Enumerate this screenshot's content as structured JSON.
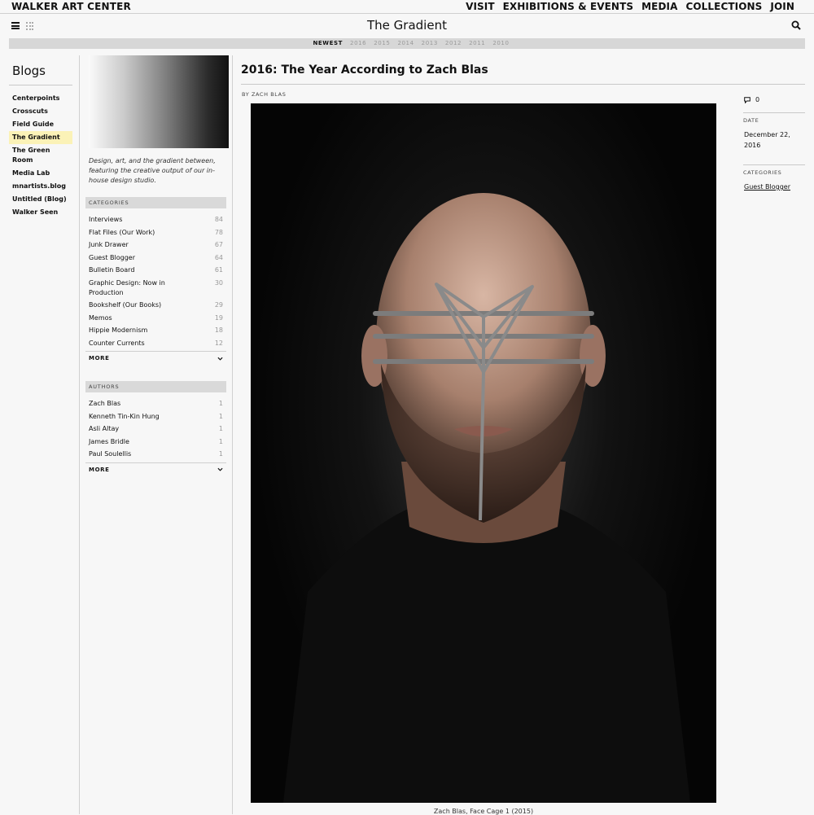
{
  "site": {
    "brand": "WALKER ART CENTER"
  },
  "topnav": [
    "VISIT",
    "EXHIBITIONS & EVENTS",
    "MEDIA",
    "COLLECTIONS",
    "JOIN"
  ],
  "header": {
    "title": "The Gradient"
  },
  "years": {
    "active": "NEWEST",
    "items": [
      "2016",
      "2015",
      "2014",
      "2013",
      "2012",
      "2011",
      "2010"
    ]
  },
  "sidebar": {
    "heading": "Blogs",
    "items": [
      {
        "label": "Centerpoints"
      },
      {
        "label": "Crosscuts"
      },
      {
        "label": "Field Guide"
      },
      {
        "label": "The Gradient",
        "active": true
      },
      {
        "label": "The Green Room"
      },
      {
        "label": "Media Lab"
      },
      {
        "label": "mnartists.blog"
      },
      {
        "label": "Untitled (Blog)"
      },
      {
        "label": "Walker Seen"
      }
    ]
  },
  "blog_info": {
    "description": "Design, art, and the gradient between, featuring the creative output of our in-house design studio.",
    "categories_heading": "CATEGORIES",
    "categories": [
      {
        "name": "Interviews",
        "count": "84"
      },
      {
        "name": "Flat Files (Our Work)",
        "count": "78"
      },
      {
        "name": "Junk Drawer",
        "count": "67"
      },
      {
        "name": "Guest Blogger",
        "count": "64"
      },
      {
        "name": "Bulletin Board",
        "count": "61"
      },
      {
        "name": "Graphic Design: Now in Production",
        "count": "30"
      },
      {
        "name": "Bookshelf (Our Books)",
        "count": "29"
      },
      {
        "name": "Memos",
        "count": "19"
      },
      {
        "name": "Hippie Modernism",
        "count": "18"
      },
      {
        "name": "Counter Currents",
        "count": "12"
      }
    ],
    "authors_heading": "AUTHORS",
    "authors": [
      {
        "name": "Zach Blas",
        "count": "1"
      },
      {
        "name": "Kenneth Tin-Kin Hung",
        "count": "1"
      },
      {
        "name": "Asli Altay",
        "count": "1"
      },
      {
        "name": "James Bridle",
        "count": "1"
      },
      {
        "name": "Paul Soulellis",
        "count": "1"
      }
    ],
    "more_label": "MORE"
  },
  "article": {
    "title": "2016: The Year According to Zach Blas",
    "byline": "BY ZACH BLAS",
    "caption": "Zach Blas, Face Cage 1 (2015)",
    "comments": "0",
    "date_label": "DATE",
    "date": "December 22, 2016",
    "categories_label": "CATEGORIES",
    "category": "Guest Blogger"
  }
}
